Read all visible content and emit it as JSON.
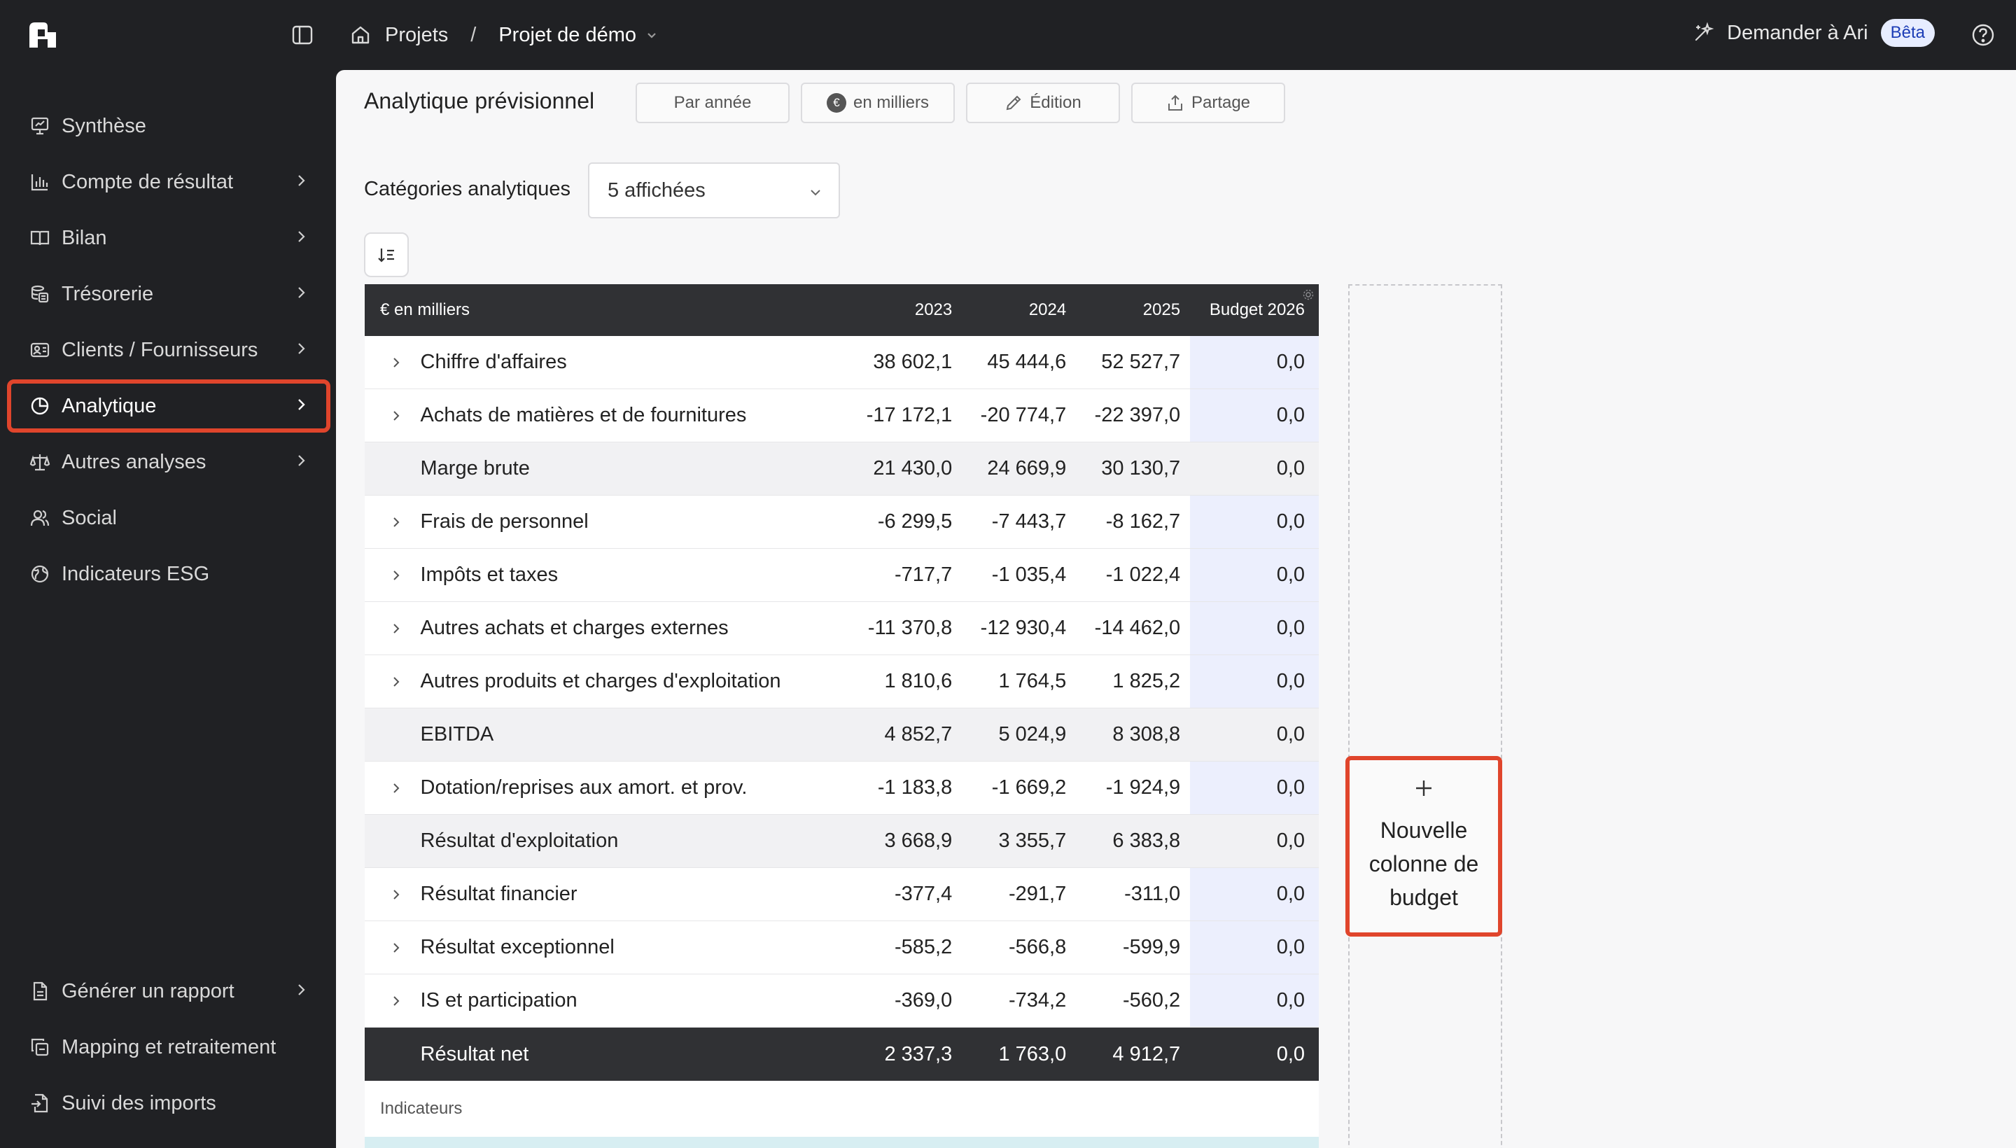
{
  "topbar": {
    "crumb_projects": "Projets",
    "crumb_sep": "/",
    "crumb_current": "Projet de démo",
    "ask_label": "Demander à Ari",
    "beta_badge": "Bêta"
  },
  "sidebar": {
    "items": [
      {
        "label": "Synthèse",
        "icon": "presentation-icon",
        "arrow": false
      },
      {
        "label": "Compte de résultat",
        "icon": "bar-chart-icon",
        "arrow": true
      },
      {
        "label": "Bilan",
        "icon": "book-open-icon",
        "arrow": true
      },
      {
        "label": "Trésorerie",
        "icon": "coins-icon",
        "arrow": true
      },
      {
        "label": "Clients / Fournisseurs",
        "icon": "id-card-icon",
        "arrow": true
      },
      {
        "label": "Analytique",
        "icon": "pie-chart-icon",
        "arrow": true,
        "active": true
      },
      {
        "label": "Autres analyses",
        "icon": "scale-icon",
        "arrow": true
      },
      {
        "label": "Social",
        "icon": "users-icon",
        "arrow": false
      },
      {
        "label": "Indicateurs ESG",
        "icon": "globe-icon",
        "arrow": false
      }
    ],
    "bottom_items": [
      {
        "label": "Générer un rapport",
        "icon": "file-icon",
        "arrow": true
      },
      {
        "label": "Mapping et retraitement",
        "icon": "copy-icon",
        "arrow": false
      },
      {
        "label": "Suivi des imports",
        "icon": "file-import-icon",
        "arrow": false
      }
    ]
  },
  "main": {
    "title": "Analytique prévisionnel",
    "toolbar": {
      "period": "Par année",
      "currency_symbol": "€",
      "unit": "en milliers",
      "edit": "Édition",
      "share": "Partage"
    },
    "categories_label": "Catégories analytiques",
    "categories_value": "5 affichées",
    "table": {
      "unit_header": "€ en milliers",
      "years": [
        "2023",
        "2024",
        "2025"
      ],
      "budget_header": "Budget 2026",
      "rows": [
        {
          "label": "Chiffre d'affaires",
          "expandable": true,
          "type": "normal",
          "values": [
            "38 602,1",
            "45 444,6",
            "52 527,7"
          ],
          "budget": "0,0"
        },
        {
          "label": "Achats de matières et de fournitures",
          "expandable": true,
          "type": "normal",
          "values": [
            "-17 172,1",
            "-20 774,7",
            "-22 397,0"
          ],
          "budget": "0,0"
        },
        {
          "label": "Marge brute",
          "expandable": false,
          "type": "sub",
          "values": [
            "21 430,0",
            "24 669,9",
            "30 130,7"
          ],
          "budget": "0,0"
        },
        {
          "label": "Frais de personnel",
          "expandable": true,
          "type": "normal",
          "values": [
            "-6 299,5",
            "-7 443,7",
            "-8 162,7"
          ],
          "budget": "0,0"
        },
        {
          "label": "Impôts et taxes",
          "expandable": true,
          "type": "normal",
          "values": [
            "-717,7",
            "-1 035,4",
            "-1 022,4"
          ],
          "budget": "0,0"
        },
        {
          "label": "Autres achats et charges externes",
          "expandable": true,
          "type": "normal",
          "values": [
            "-11 370,8",
            "-12 930,4",
            "-14 462,0"
          ],
          "budget": "0,0"
        },
        {
          "label": "Autres produits et charges d'exploitation",
          "expandable": true,
          "type": "normal",
          "values": [
            "1 810,6",
            "1 764,5",
            "1 825,2"
          ],
          "budget": "0,0"
        },
        {
          "label": "EBITDA",
          "expandable": false,
          "type": "sub",
          "values": [
            "4 852,7",
            "5 024,9",
            "8 308,8"
          ],
          "budget": "0,0"
        },
        {
          "label": "Dotation/reprises aux amort. et prov.",
          "expandable": true,
          "type": "normal",
          "values": [
            "-1 183,8",
            "-1 669,2",
            "-1 924,9"
          ],
          "budget": "0,0"
        },
        {
          "label": "Résultat d'exploitation",
          "expandable": false,
          "type": "sub",
          "values": [
            "3 668,9",
            "3 355,7",
            "6 383,8"
          ],
          "budget": "0,0"
        },
        {
          "label": "Résultat financier",
          "expandable": true,
          "type": "normal",
          "values": [
            "-377,4",
            "-291,7",
            "-311,0"
          ],
          "budget": "0,0"
        },
        {
          "label": "Résultat exceptionnel",
          "expandable": true,
          "type": "normal",
          "values": [
            "-585,2",
            "-566,8",
            "-599,9"
          ],
          "budget": "0,0"
        },
        {
          "label": "IS et participation",
          "expandable": true,
          "type": "normal",
          "values": [
            "-369,0",
            "-734,2",
            "-560,2"
          ],
          "budget": "0,0"
        },
        {
          "label": "Résultat net",
          "expandable": false,
          "type": "total",
          "values": [
            "2 337,3",
            "1 763,0",
            "4 912,7"
          ],
          "budget": "0,0"
        }
      ],
      "indicators_label": "Indicateurs"
    },
    "new_budget_column": "Nouvelle colonne de budget"
  },
  "colors": {
    "sidebar_bg": "#202124",
    "highlight": "#e0452c",
    "budget_cell_bg": "#eceffd",
    "beta_bg": "#e7edff",
    "beta_text": "#1c3db6"
  }
}
